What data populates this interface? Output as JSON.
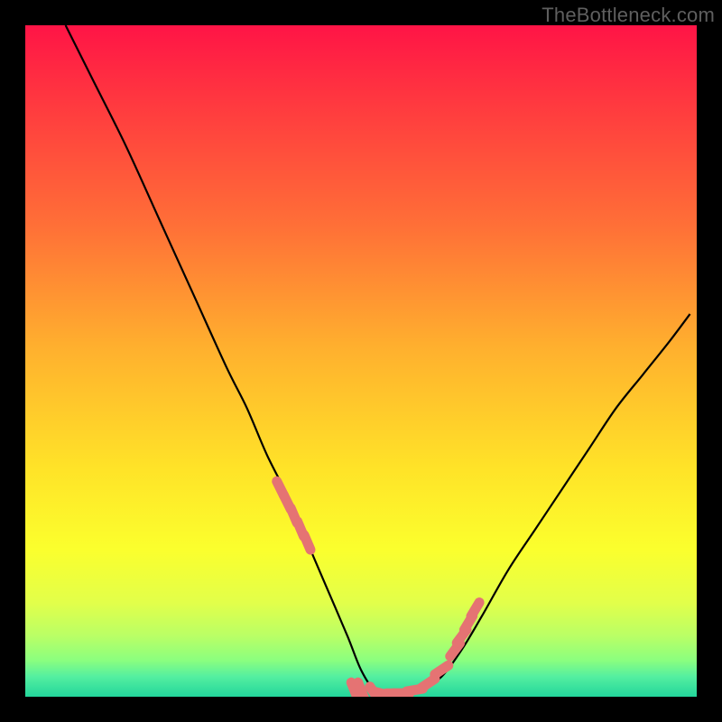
{
  "watermark": "TheBottleneck.com",
  "colors": {
    "black": "#000000",
    "curve": "#000000",
    "marker": "#e57373"
  },
  "gradient_stops": [
    {
      "offset": 0.0,
      "color": "#ff1446"
    },
    {
      "offset": 0.12,
      "color": "#ff3a3f"
    },
    {
      "offset": 0.3,
      "color": "#ff7037"
    },
    {
      "offset": 0.48,
      "color": "#ffb02e"
    },
    {
      "offset": 0.66,
      "color": "#ffe328"
    },
    {
      "offset": 0.78,
      "color": "#fbff2d"
    },
    {
      "offset": 0.86,
      "color": "#e2ff4a"
    },
    {
      "offset": 0.91,
      "color": "#b9ff66"
    },
    {
      "offset": 0.945,
      "color": "#8cff7e"
    },
    {
      "offset": 0.97,
      "color": "#54efa0"
    },
    {
      "offset": 1.0,
      "color": "#23d69b"
    }
  ],
  "chart_data": {
    "type": "line",
    "title": "",
    "xlabel": "",
    "ylabel": "",
    "xlim": [
      0,
      100
    ],
    "ylim": [
      0,
      100
    ],
    "series": [
      {
        "name": "curve",
        "x": [
          6,
          10,
          15,
          20,
          25,
          30,
          33,
          36,
          39,
          42,
          45,
          48,
          50,
          52,
          54,
          56,
          59,
          62,
          65,
          68,
          72,
          76,
          80,
          84,
          88,
          92,
          96,
          99
        ],
        "values": [
          100,
          92,
          82,
          71,
          60,
          49,
          43,
          36,
          30,
          23,
          16,
          9,
          4,
          1,
          0.5,
          0.5,
          1,
          3,
          7,
          12,
          19,
          25,
          31,
          37,
          43,
          48,
          53,
          57
        ]
      }
    ],
    "markers": {
      "name": "highlighted-points",
      "x": [
        38,
        39,
        40,
        41,
        42,
        49,
        50,
        52,
        53,
        55,
        56,
        58,
        60,
        62,
        64,
        65,
        66,
        67
      ],
      "values": [
        31,
        29,
        27,
        25,
        23,
        1,
        1,
        0.5,
        0.5,
        0.5,
        0.5,
        1,
        2,
        4,
        7,
        9,
        11,
        13
      ]
    }
  }
}
